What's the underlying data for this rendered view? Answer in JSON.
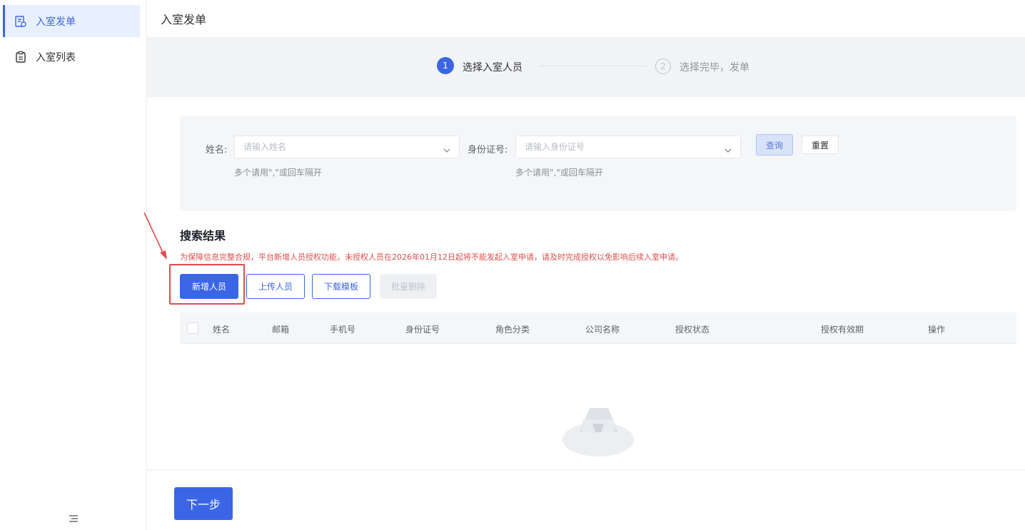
{
  "sidebar": {
    "items": [
      {
        "label": "入室发单",
        "icon": "form-icon",
        "active": true
      },
      {
        "label": "入室列表",
        "icon": "clipboard-icon",
        "active": false
      }
    ],
    "collapse_icon": "menu-fold-icon"
  },
  "header": {
    "title": "入室发单"
  },
  "steps": [
    {
      "number": "1",
      "label": "选择入室人员",
      "status": "active"
    },
    {
      "number": "2",
      "label": "选择完毕，发单",
      "status": "pending"
    }
  ],
  "search": {
    "name_label": "姓名:",
    "name_placeholder": "请输入姓名",
    "name_help": "多个请用\",\"或回车隔开",
    "id_label": "身份证号:",
    "id_placeholder": "请输入身份证号",
    "id_help": "多个请用\",\"或回车隔开",
    "query_button": "查询",
    "reset_button": "重置"
  },
  "results": {
    "title": "搜索结果",
    "notice": "为保障信息完整合规，平台新增人员授权功能，未授权人员在2026年01月12日起将不能发起入室申请，请及时完成授权以免影响后续入室申请。",
    "buttons": {
      "add": "新增人员",
      "upload": "上传人员",
      "download": "下载模板",
      "disabled": "批量删除"
    }
  },
  "table": {
    "columns": [
      "姓名",
      "邮箱",
      "手机号",
      "身份证号",
      "角色分类",
      "公司名称",
      "授权状态",
      "授权有效期",
      "操作"
    ]
  },
  "footer": {
    "next_button": "下一步"
  },
  "colors": {
    "primary": "#3a66e6",
    "danger": "#e34d4d",
    "background": "#f2f3f5"
  }
}
